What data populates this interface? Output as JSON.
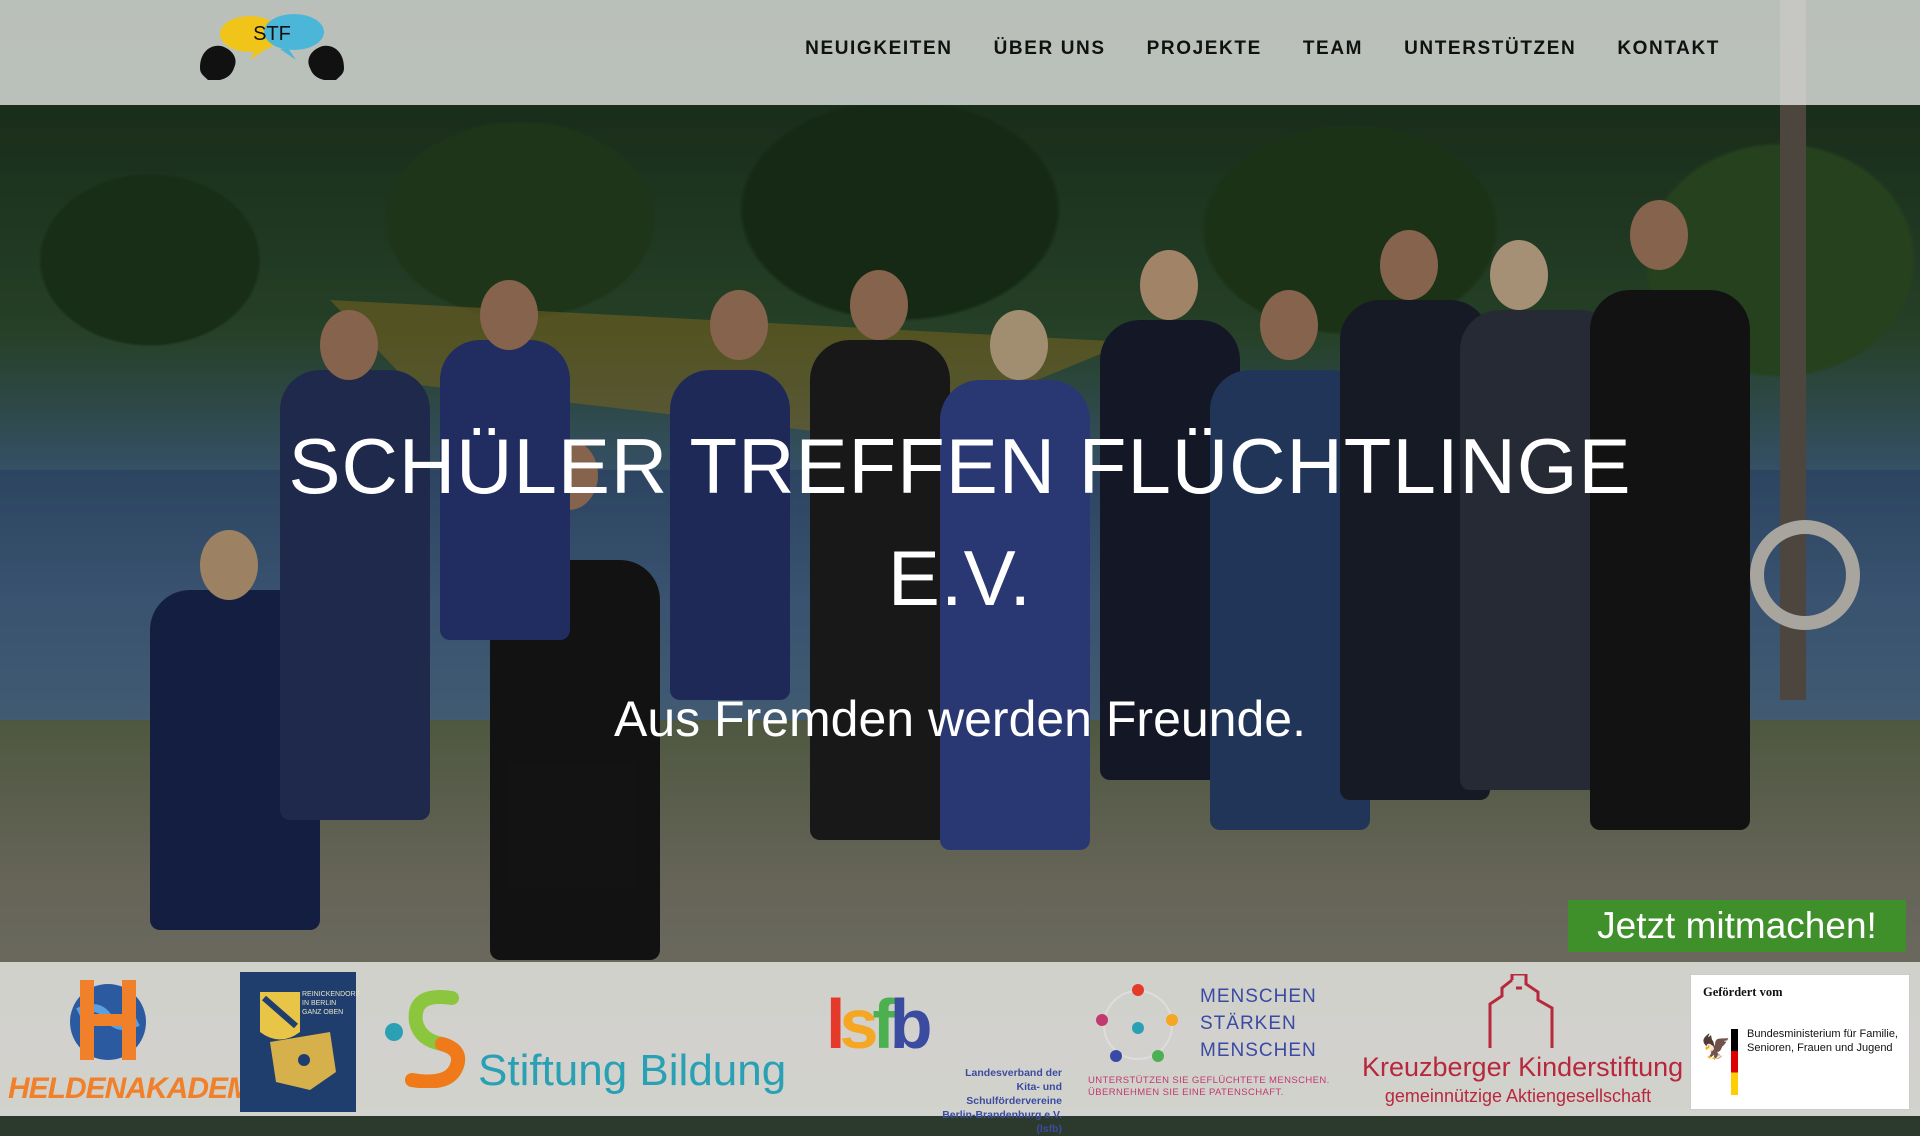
{
  "site": {
    "logo_text": "STF",
    "nav": [
      {
        "label": "NEUIGKEITEN"
      },
      {
        "label": "ÜBER UNS"
      },
      {
        "label": "PROJEKTE"
      },
      {
        "label": "TEAM"
      },
      {
        "label": "UNTERSTÜTZEN"
      },
      {
        "label": "KONTAKT"
      }
    ]
  },
  "hero": {
    "title_line1": "SCHÜLER TREFFEN FLÜCHTLINGE",
    "title_line2": "E.V.",
    "tagline": "Aus Fremden werden Freunde.",
    "cta": "Jetzt mitmachen!"
  },
  "sponsors": {
    "heldenakademie": "HELDENAKADEMIE",
    "reinickendorf": "REINICKENDORF IN BERLIN GANZ OBEN",
    "stiftung_bildung": "Stiftung Bildung",
    "lsfb_mark": "lsfb",
    "lsfb_text": "Landesverband der Kita- und Schulfördervereine Berlin-Brandenburg e.V. (lsfb)",
    "msm_line1": "MENSCHEN",
    "msm_line2": "STÄRKEN",
    "msm_line3": "MENSCHEN",
    "msm_sub": "UNTERSTÜTZEN SIE GEFLÜCHTETE MENSCHEN. ÜBERNEHMEN SIE EINE PATENSCHAFT.",
    "kreuzberger_1": "Kreuzberger Kinderstiftung",
    "kreuzberger_2": "gemeinnützige Aktiengesellschaft",
    "bmfsfj_head": "Gefördert vom",
    "bmfsfj_text": "Bundesministerium für Familie, Senioren, Frauen und Jugend"
  },
  "colors": {
    "cta_green": "#3f8f2a",
    "header_bg": "#e8ebe8",
    "kreuzberg_red": "#b8283c",
    "stiftung_teal": "#2aa0b4",
    "held_orange": "#f0802a"
  }
}
